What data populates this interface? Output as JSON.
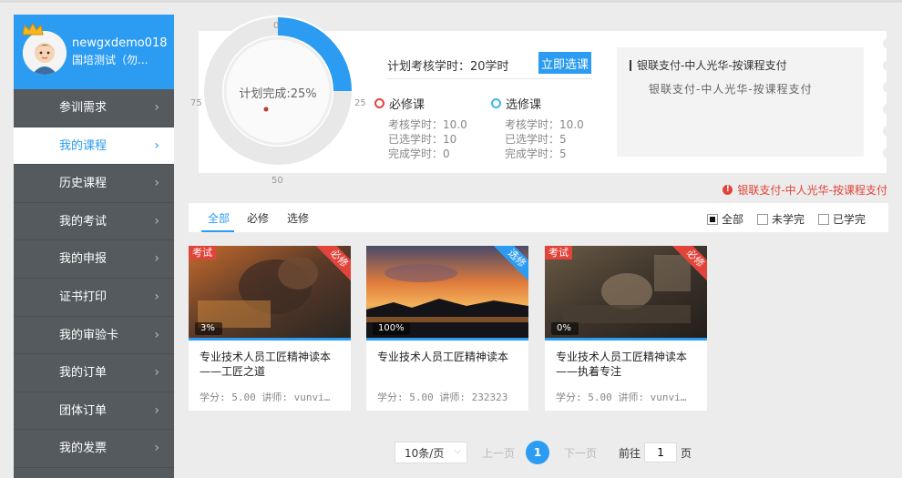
{
  "user": {
    "name": "newgxdemo018",
    "org": "国培测试（勿..."
  },
  "sidebar": {
    "items": [
      {
        "label": "参训需求"
      },
      {
        "label": "我的课程"
      },
      {
        "label": "历史课程"
      },
      {
        "label": "我的考试"
      },
      {
        "label": "我的申报"
      },
      {
        "label": "证书打印"
      },
      {
        "label": "我的审验卡"
      },
      {
        "label": "我的订单"
      },
      {
        "label": "团体订单"
      },
      {
        "label": "我的发票"
      }
    ],
    "active_index": 1,
    "chevron": "›"
  },
  "gauge": {
    "label": "计划完成:25%",
    "percent": 25,
    "ticks": {
      "top": "0",
      "right": "25",
      "bottom": "50",
      "left": "75"
    },
    "color": "#2b9cf2"
  },
  "plan": {
    "label": "计划考核学时：20学时",
    "button": "立即选课"
  },
  "required": {
    "title": "必修课",
    "assess": "考核学时：10.0",
    "selected": "已选学时：10",
    "done": "完成学时：0"
  },
  "elective": {
    "title": "选修课",
    "assess": "考核学时：10.0",
    "selected": "已选学时：5",
    "done": "完成学时：5"
  },
  "payment": {
    "title": "银联支付-中人光华-按课程支付",
    "subtitle": "银联支付-中人光华-按课程支付",
    "alert": "银联支付-中人光华-按课程支付",
    "alert_icon": "!"
  },
  "filters": {
    "tabs": [
      "全部",
      "必修",
      "选修"
    ],
    "active_tab": 0,
    "checks": [
      {
        "label": "全部",
        "checked": true
      },
      {
        "label": "未学完",
        "checked": false
      },
      {
        "label": "已学完",
        "checked": false
      }
    ]
  },
  "courses": [
    {
      "title": "专业技术人员工匠精神读本——工匠之道",
      "meta": "学分: 5.00 讲师: vunvi…",
      "progress": "3%",
      "exam_badge": "考试",
      "ribbon": "必修"
    },
    {
      "title": "专业技术人员工匠精神读本",
      "meta": "学分: 5.00 讲师: 232323",
      "progress": "100%",
      "exam_badge": "",
      "ribbon": "选修"
    },
    {
      "title": "专业技术人员工匠精神读本——执着专注",
      "meta": "学分: 5.00 讲师: vunvi…",
      "progress": "0%",
      "exam_badge": "考试",
      "ribbon": "必修"
    }
  ],
  "pagination": {
    "page_size": "10条/页",
    "prev": "上一页",
    "current": "1",
    "next": "下一页",
    "goto_prefix": "前往",
    "goto_value": "1",
    "goto_suffix": "页"
  },
  "colors": {
    "accent": "#2b9cf2",
    "danger": "#e0443a",
    "sidebar_bg": "#555a5e"
  }
}
